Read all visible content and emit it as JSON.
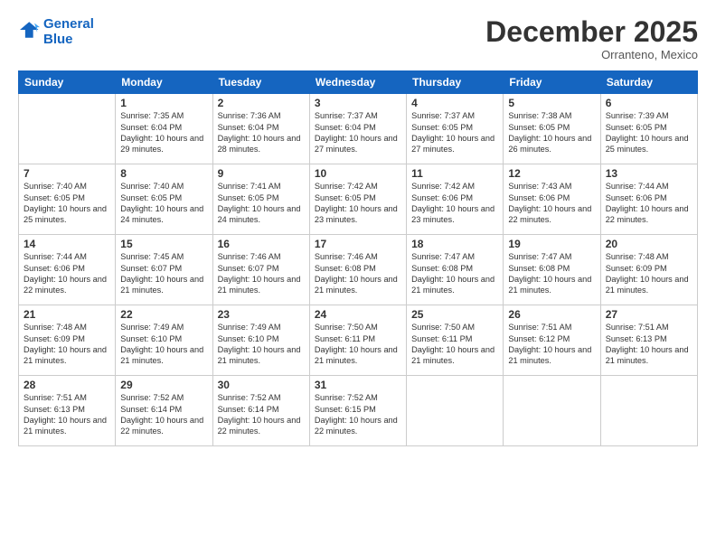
{
  "logo": {
    "line1": "General",
    "line2": "Blue"
  },
  "title": "December 2025",
  "location": "Orranteno, Mexico",
  "weekdays": [
    "Sunday",
    "Monday",
    "Tuesday",
    "Wednesday",
    "Thursday",
    "Friday",
    "Saturday"
  ],
  "weeks": [
    [
      {
        "day": "",
        "sunrise": "",
        "sunset": "",
        "daylight": ""
      },
      {
        "day": "1",
        "sunrise": "Sunrise: 7:35 AM",
        "sunset": "Sunset: 6:04 PM",
        "daylight": "Daylight: 10 hours and 29 minutes."
      },
      {
        "day": "2",
        "sunrise": "Sunrise: 7:36 AM",
        "sunset": "Sunset: 6:04 PM",
        "daylight": "Daylight: 10 hours and 28 minutes."
      },
      {
        "day": "3",
        "sunrise": "Sunrise: 7:37 AM",
        "sunset": "Sunset: 6:04 PM",
        "daylight": "Daylight: 10 hours and 27 minutes."
      },
      {
        "day": "4",
        "sunrise": "Sunrise: 7:37 AM",
        "sunset": "Sunset: 6:05 PM",
        "daylight": "Daylight: 10 hours and 27 minutes."
      },
      {
        "day": "5",
        "sunrise": "Sunrise: 7:38 AM",
        "sunset": "Sunset: 6:05 PM",
        "daylight": "Daylight: 10 hours and 26 minutes."
      },
      {
        "day": "6",
        "sunrise": "Sunrise: 7:39 AM",
        "sunset": "Sunset: 6:05 PM",
        "daylight": "Daylight: 10 hours and 25 minutes."
      }
    ],
    [
      {
        "day": "7",
        "sunrise": "Sunrise: 7:40 AM",
        "sunset": "Sunset: 6:05 PM",
        "daylight": "Daylight: 10 hours and 25 minutes."
      },
      {
        "day": "8",
        "sunrise": "Sunrise: 7:40 AM",
        "sunset": "Sunset: 6:05 PM",
        "daylight": "Daylight: 10 hours and 24 minutes."
      },
      {
        "day": "9",
        "sunrise": "Sunrise: 7:41 AM",
        "sunset": "Sunset: 6:05 PM",
        "daylight": "Daylight: 10 hours and 24 minutes."
      },
      {
        "day": "10",
        "sunrise": "Sunrise: 7:42 AM",
        "sunset": "Sunset: 6:05 PM",
        "daylight": "Daylight: 10 hours and 23 minutes."
      },
      {
        "day": "11",
        "sunrise": "Sunrise: 7:42 AM",
        "sunset": "Sunset: 6:06 PM",
        "daylight": "Daylight: 10 hours and 23 minutes."
      },
      {
        "day": "12",
        "sunrise": "Sunrise: 7:43 AM",
        "sunset": "Sunset: 6:06 PM",
        "daylight": "Daylight: 10 hours and 22 minutes."
      },
      {
        "day": "13",
        "sunrise": "Sunrise: 7:44 AM",
        "sunset": "Sunset: 6:06 PM",
        "daylight": "Daylight: 10 hours and 22 minutes."
      }
    ],
    [
      {
        "day": "14",
        "sunrise": "Sunrise: 7:44 AM",
        "sunset": "Sunset: 6:06 PM",
        "daylight": "Daylight: 10 hours and 22 minutes."
      },
      {
        "day": "15",
        "sunrise": "Sunrise: 7:45 AM",
        "sunset": "Sunset: 6:07 PM",
        "daylight": "Daylight: 10 hours and 21 minutes."
      },
      {
        "day": "16",
        "sunrise": "Sunrise: 7:46 AM",
        "sunset": "Sunset: 6:07 PM",
        "daylight": "Daylight: 10 hours and 21 minutes."
      },
      {
        "day": "17",
        "sunrise": "Sunrise: 7:46 AM",
        "sunset": "Sunset: 6:08 PM",
        "daylight": "Daylight: 10 hours and 21 minutes."
      },
      {
        "day": "18",
        "sunrise": "Sunrise: 7:47 AM",
        "sunset": "Sunset: 6:08 PM",
        "daylight": "Daylight: 10 hours and 21 minutes."
      },
      {
        "day": "19",
        "sunrise": "Sunrise: 7:47 AM",
        "sunset": "Sunset: 6:08 PM",
        "daylight": "Daylight: 10 hours and 21 minutes."
      },
      {
        "day": "20",
        "sunrise": "Sunrise: 7:48 AM",
        "sunset": "Sunset: 6:09 PM",
        "daylight": "Daylight: 10 hours and 21 minutes."
      }
    ],
    [
      {
        "day": "21",
        "sunrise": "Sunrise: 7:48 AM",
        "sunset": "Sunset: 6:09 PM",
        "daylight": "Daylight: 10 hours and 21 minutes."
      },
      {
        "day": "22",
        "sunrise": "Sunrise: 7:49 AM",
        "sunset": "Sunset: 6:10 PM",
        "daylight": "Daylight: 10 hours and 21 minutes."
      },
      {
        "day": "23",
        "sunrise": "Sunrise: 7:49 AM",
        "sunset": "Sunset: 6:10 PM",
        "daylight": "Daylight: 10 hours and 21 minutes."
      },
      {
        "day": "24",
        "sunrise": "Sunrise: 7:50 AM",
        "sunset": "Sunset: 6:11 PM",
        "daylight": "Daylight: 10 hours and 21 minutes."
      },
      {
        "day": "25",
        "sunrise": "Sunrise: 7:50 AM",
        "sunset": "Sunset: 6:11 PM",
        "daylight": "Daylight: 10 hours and 21 minutes."
      },
      {
        "day": "26",
        "sunrise": "Sunrise: 7:51 AM",
        "sunset": "Sunset: 6:12 PM",
        "daylight": "Daylight: 10 hours and 21 minutes."
      },
      {
        "day": "27",
        "sunrise": "Sunrise: 7:51 AM",
        "sunset": "Sunset: 6:13 PM",
        "daylight": "Daylight: 10 hours and 21 minutes."
      }
    ],
    [
      {
        "day": "28",
        "sunrise": "Sunrise: 7:51 AM",
        "sunset": "Sunset: 6:13 PM",
        "daylight": "Daylight: 10 hours and 21 minutes."
      },
      {
        "day": "29",
        "sunrise": "Sunrise: 7:52 AM",
        "sunset": "Sunset: 6:14 PM",
        "daylight": "Daylight: 10 hours and 22 minutes."
      },
      {
        "day": "30",
        "sunrise": "Sunrise: 7:52 AM",
        "sunset": "Sunset: 6:14 PM",
        "daylight": "Daylight: 10 hours and 22 minutes."
      },
      {
        "day": "31",
        "sunrise": "Sunrise: 7:52 AM",
        "sunset": "Sunset: 6:15 PM",
        "daylight": "Daylight: 10 hours and 22 minutes."
      },
      {
        "day": "",
        "sunrise": "",
        "sunset": "",
        "daylight": ""
      },
      {
        "day": "",
        "sunrise": "",
        "sunset": "",
        "daylight": ""
      },
      {
        "day": "",
        "sunrise": "",
        "sunset": "",
        "daylight": ""
      }
    ]
  ]
}
